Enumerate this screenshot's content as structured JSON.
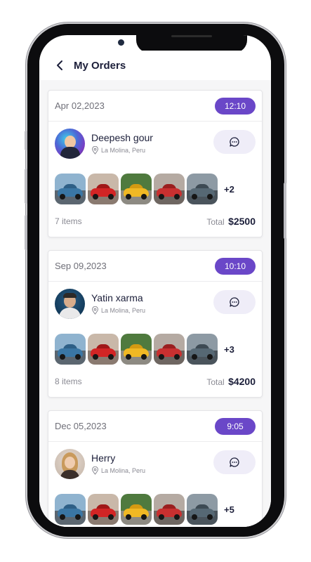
{
  "header": {
    "title": "My Orders"
  },
  "orders": [
    {
      "date": "Apr 02,2023",
      "time": "12:10",
      "customer": {
        "name": "Deepesh gour",
        "location": "La Molina, Peru"
      },
      "extra_count": "+2",
      "items_label": "7 items",
      "total_label": "Total",
      "total_value": "$2500"
    },
    {
      "date": "Sep 09,2023",
      "time": "10:10",
      "customer": {
        "name": "Yatin xarma",
        "location": "La Molina, Peru"
      },
      "extra_count": "+3",
      "items_label": "8 items",
      "total_label": "Total",
      "total_value": "$4200"
    },
    {
      "date": "Dec 05,2023",
      "time": "9:05",
      "customer": {
        "name": "Herry",
        "location": "La Molina, Peru"
      },
      "extra_count": "+5",
      "items_label": "",
      "total_label": "",
      "total_value": ""
    }
  ],
  "colors": {
    "accent": "#6a47c8",
    "chat_bg": "#efedf8",
    "title": "#1c1f3a",
    "muted": "#8a8a93"
  },
  "icons": [
    "back-arrow-icon",
    "location-pin-icon",
    "chat-bubble-icon"
  ]
}
